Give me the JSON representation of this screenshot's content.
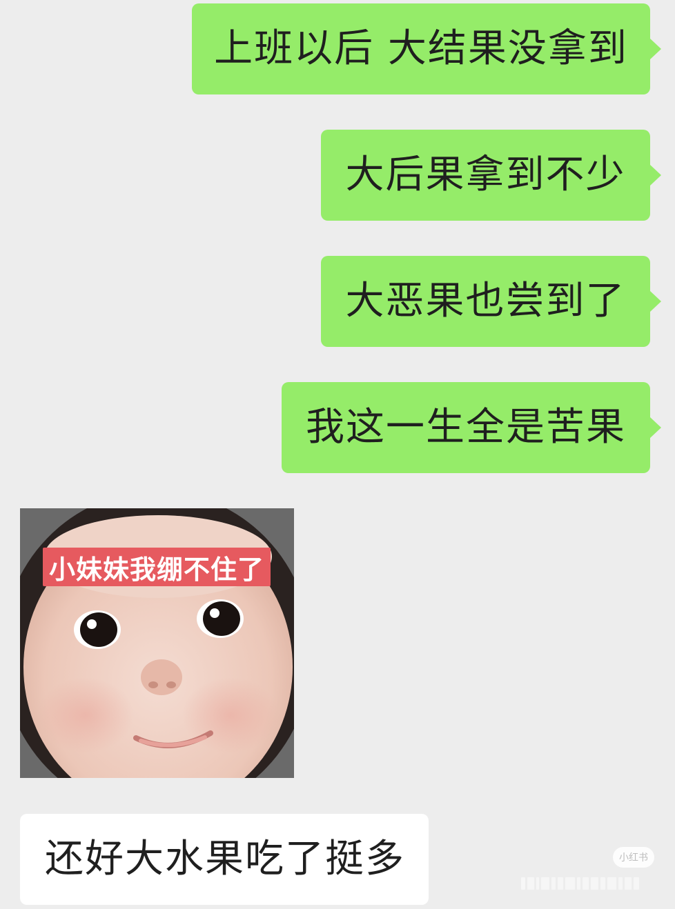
{
  "messages": [
    {
      "side": "sent",
      "text": "上班以后 大结果没拿到"
    },
    {
      "side": "sent",
      "text": "大后果拿到不少"
    },
    {
      "side": "sent",
      "text": "大恶果也尝到了"
    },
    {
      "side": "sent",
      "text": "我这一生全是苦果"
    },
    {
      "side": "received",
      "type": "sticker",
      "caption": "小妹妹我绷不住了"
    },
    {
      "side": "received",
      "text": "还好大水果吃了挺多"
    }
  ],
  "watermark": {
    "text": "小红书"
  },
  "colors": {
    "background": "#ededed",
    "sent_bubble": "#95ec69",
    "received_bubble": "#ffffff",
    "sticker_caption_bg": "#e65a5f"
  }
}
